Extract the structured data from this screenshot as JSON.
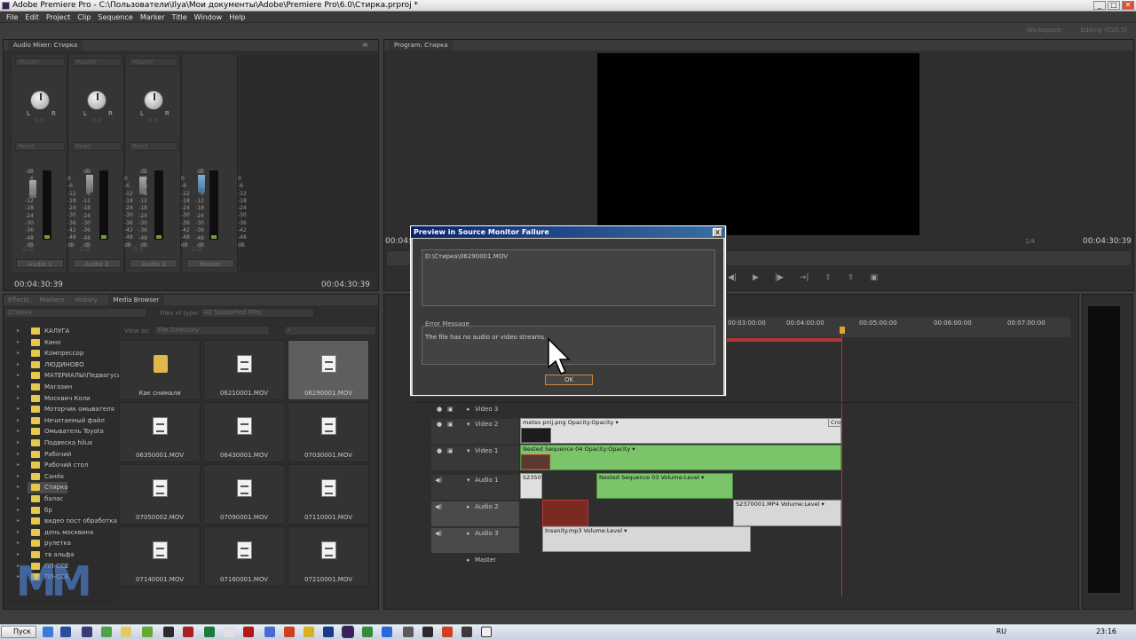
{
  "window": {
    "title": "Adobe Premiere Pro - C:\\Пользователи\\Ilya\\Мои документы\\Adobe\\Premiere Pro\\6.0\\Стирка.prproj *"
  },
  "menu": [
    "File",
    "Edit",
    "Project",
    "Clip",
    "Sequence",
    "Marker",
    "Title",
    "Window",
    "Help"
  ],
  "workspace": {
    "label": "Workspace:",
    "value": "Editing (CS5.5)"
  },
  "audio_mixer": {
    "tab": "Audio Mixer: Стирка",
    "channels": [
      {
        "selector": "Master",
        "pan": "0.0",
        "mode": "Read",
        "level": "0.0",
        "name": "Audio 1"
      },
      {
        "selector": "Master",
        "pan": "0.0",
        "mode": "Read",
        "level": "0.0",
        "name": "Audio 2"
      },
      {
        "selector": "Master",
        "pan": "0.0",
        "mode": "Read",
        "level": "0.0",
        "name": "Audio 3"
      },
      {
        "selector": "",
        "pan": "",
        "mode": "",
        "level": "0.0",
        "name": "Master"
      }
    ],
    "scale": [
      "dB",
      "6",
      "0",
      "-6",
      "-12",
      "-18",
      "-24",
      "-30",
      "-36",
      "-48",
      "dB"
    ],
    "scale_right": [
      "0",
      "-6",
      "-12",
      "-18",
      "-24",
      "-30",
      "-36",
      "-42",
      "-48",
      "dB"
    ],
    "timecode_left": "00:04:30:39",
    "timecode_right": "00:04:30:39"
  },
  "program_monitor": {
    "tab": "Program: Стирка",
    "timecode_left": "00:04:",
    "fit": "1/4",
    "timecode_right": "00:04:30:39"
  },
  "media_browser": {
    "tabs": [
      "Effects",
      "Markers",
      "History",
      "Media Browser"
    ],
    "location": "Стирка",
    "files_of_type_label": "Files of type:",
    "files_of_type": "All Supported Files",
    "view_as_label": "View as:",
    "view_as": "File Directory",
    "tree": [
      "КАЛУГА",
      "Кино",
      "Компрессор",
      "ЛЮДИНОВО",
      "МАТЕРИАЛЫ\\Педвагуси",
      "Магазин",
      "Москвич Коли",
      "Моторчик омывателя",
      "Нечитаемый файл",
      "Омыватель Toyota",
      "Подвеска hilux",
      "Рабочий",
      "Рабочий стол",
      "Санёк",
      "Стирка",
      "балас",
      "бр",
      "видео пост обработка",
      "день москвина",
      "рулетка",
      "тв альфа",
      "ПП-ССЕ",
      "ПП-ССЕ"
    ],
    "selected_tree": "Стирка",
    "thumbs": [
      "Как снимали",
      "06210001.MOV",
      "06290001.MOV",
      "06350001.MOV",
      "06430001.MOV",
      "07030001.MOV",
      "07050002.MOV",
      "07090001.MOV",
      "07110001.MOV",
      "07140001.MOV",
      "07160001.MOV",
      "07210001.MOV"
    ],
    "selected_thumb": "06290001.MOV"
  },
  "timeline": {
    "ruler": [
      "00:03:00:00",
      "00:04:00:00",
      "00:05:00:00",
      "00:06:00:00",
      "00:07:00:00"
    ],
    "tracks": [
      "Video 3",
      "Video 2",
      "Video 1",
      "Audio 1",
      "Audio 2",
      "Audio 3",
      "Master"
    ],
    "clips": {
      "v2_a": "metso pnij.png  Opacity:Opacity ▾",
      "v2_b": "Cro",
      "v1_a": "Nested Sequence 04  Opacity:Opacity ▾",
      "a1_a": "S2350",
      "a1_b": "Nested Sequence 03  Volume:Level ▾",
      "a2_a": "S2370001.MP4  Volume:Level ▾",
      "a3_a": "Insanity.mp3  Volume:Level ▾"
    }
  },
  "dialog": {
    "title": "Preview in Source Monitor Failure",
    "path": "D:\\Стирка\\06290001.MOV",
    "error_label": "Error Message",
    "error_text": "The file has no audio or video streams.",
    "ok": "OK",
    "close": "x"
  },
  "taskbar": {
    "start": "Пуск",
    "lang": "RU",
    "clock": "23:16"
  },
  "watermark": "MM"
}
